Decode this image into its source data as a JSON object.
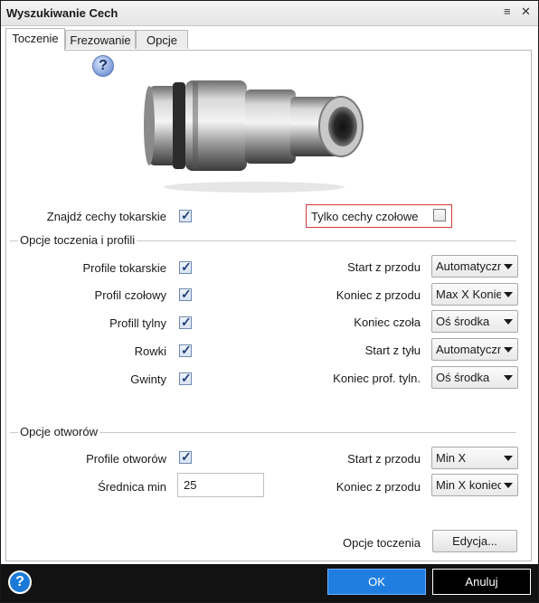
{
  "window": {
    "title": "Wyszukiwanie Cech",
    "menu_icon": "menu-icon",
    "close_icon": "close-icon"
  },
  "tabs": [
    {
      "label": "Toczenie",
      "active": true
    },
    {
      "label": "Frezowanie",
      "active": false
    },
    {
      "label": "Opcje",
      "active": false
    }
  ],
  "help_glyph": "?",
  "find_turning": {
    "label": "Znajdź cechy tokarskie",
    "checked": true
  },
  "face_only": {
    "label": "Tylko cechy czołowe",
    "checked": false
  },
  "turning_group": {
    "title": "Opcje toczenia i profili",
    "checks": [
      {
        "label": "Profile tokarskie",
        "checked": true
      },
      {
        "label": "Profil czołowy",
        "checked": true
      },
      {
        "label": "Profill tylny",
        "checked": true
      },
      {
        "label": "Rowki",
        "checked": true
      },
      {
        "label": "Gwinty",
        "checked": true
      }
    ],
    "combos": [
      {
        "label": "Start z przodu",
        "value": "Automatyczny"
      },
      {
        "label": "Koniec z przodu",
        "value": "Max X Koniec"
      },
      {
        "label": "Koniec czoła",
        "value": "Oś środka"
      },
      {
        "label": "Start z tyłu",
        "value": "Automatyczny"
      },
      {
        "label": "Koniec prof. tyln.",
        "value": "Oś środka"
      }
    ]
  },
  "holes_group": {
    "title": "Opcje otworów",
    "hole_profiles": {
      "label": "Profile otworów",
      "checked": true
    },
    "min_diameter": {
      "label": "Średnica min",
      "value": "25"
    },
    "combos": [
      {
        "label": "Start z przodu",
        "value": "Min X"
      },
      {
        "label": "Koniec z przodu",
        "value": "Min X koniec"
      }
    ]
  },
  "turning_options": {
    "label": "Opcje toczenia",
    "button": "Edycja..."
  },
  "footer": {
    "help_glyph": "?",
    "ok": "OK",
    "cancel": "Anuluj",
    "accent_color": "#1f7ee0"
  }
}
